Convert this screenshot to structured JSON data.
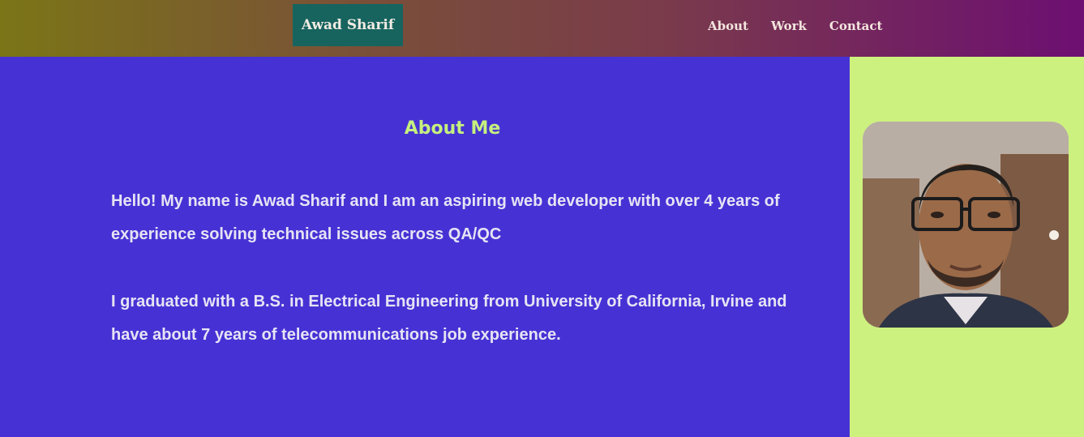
{
  "header": {
    "brand": "Awad Sharif",
    "nav": [
      {
        "label": "About"
      },
      {
        "label": "Work"
      },
      {
        "label": "Contact"
      }
    ]
  },
  "about": {
    "heading": "About Me",
    "paragraph_1": "Hello! My name is Awad Sharif and I am an aspiring web developer with over 4 years of experience solving technical issues across QA/QC",
    "paragraph_2": "I graduated with a B.S. in Electrical Engineering from University of California, Irvine and have about 7 years of telecommunications job experience."
  },
  "colors": {
    "main_bg": "#4632d4",
    "sidebar_bg": "#cdf17f",
    "heading": "#c6f07e",
    "brand_bg": "#17645f"
  }
}
